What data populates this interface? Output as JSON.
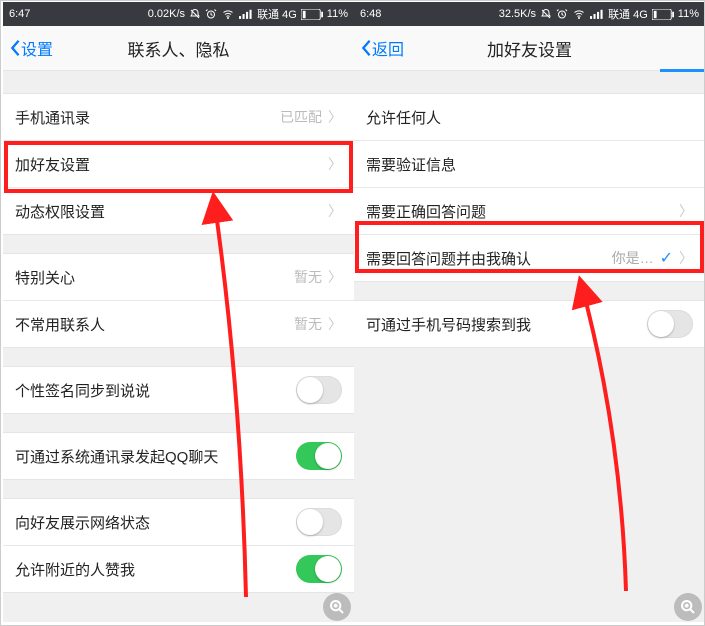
{
  "left": {
    "status": {
      "time": "6:47",
      "speed": "0.02K/s",
      "carrier": "联通 4G",
      "battery": "11%"
    },
    "nav": {
      "back": "设置",
      "title": "联系人、隐私"
    },
    "rows": {
      "contacts": {
        "label": "手机通讯录",
        "detail": "已匹配"
      },
      "addFriend": {
        "label": "加好友设置"
      },
      "moments": {
        "label": "动态权限设置"
      },
      "special": {
        "label": "特别关心",
        "detail": "暂无"
      },
      "rare": {
        "label": "不常用联系人",
        "detail": "暂无"
      },
      "sig": {
        "label": "个性签名同步到说说"
      },
      "qq": {
        "label": "可通过系统通讯录发起QQ聊天"
      },
      "net": {
        "label": "向好友展示网络状态"
      },
      "nearby": {
        "label": "允许附近的人赞我"
      }
    }
  },
  "right": {
    "status": {
      "time": "6:48",
      "speed": "32.5K/s",
      "carrier": "联通 4G",
      "battery": "11%"
    },
    "nav": {
      "back": "返回",
      "title": "加好友设置"
    },
    "rows": {
      "anyone": {
        "label": "允许任何人"
      },
      "verify": {
        "label": "需要验证信息"
      },
      "answer": {
        "label": "需要正确回答问题"
      },
      "confirm": {
        "label": "需要回答问题并由我确认",
        "detail": "你是…"
      },
      "searchPhone": {
        "label": "可通过手机号码搜索到我"
      }
    }
  }
}
